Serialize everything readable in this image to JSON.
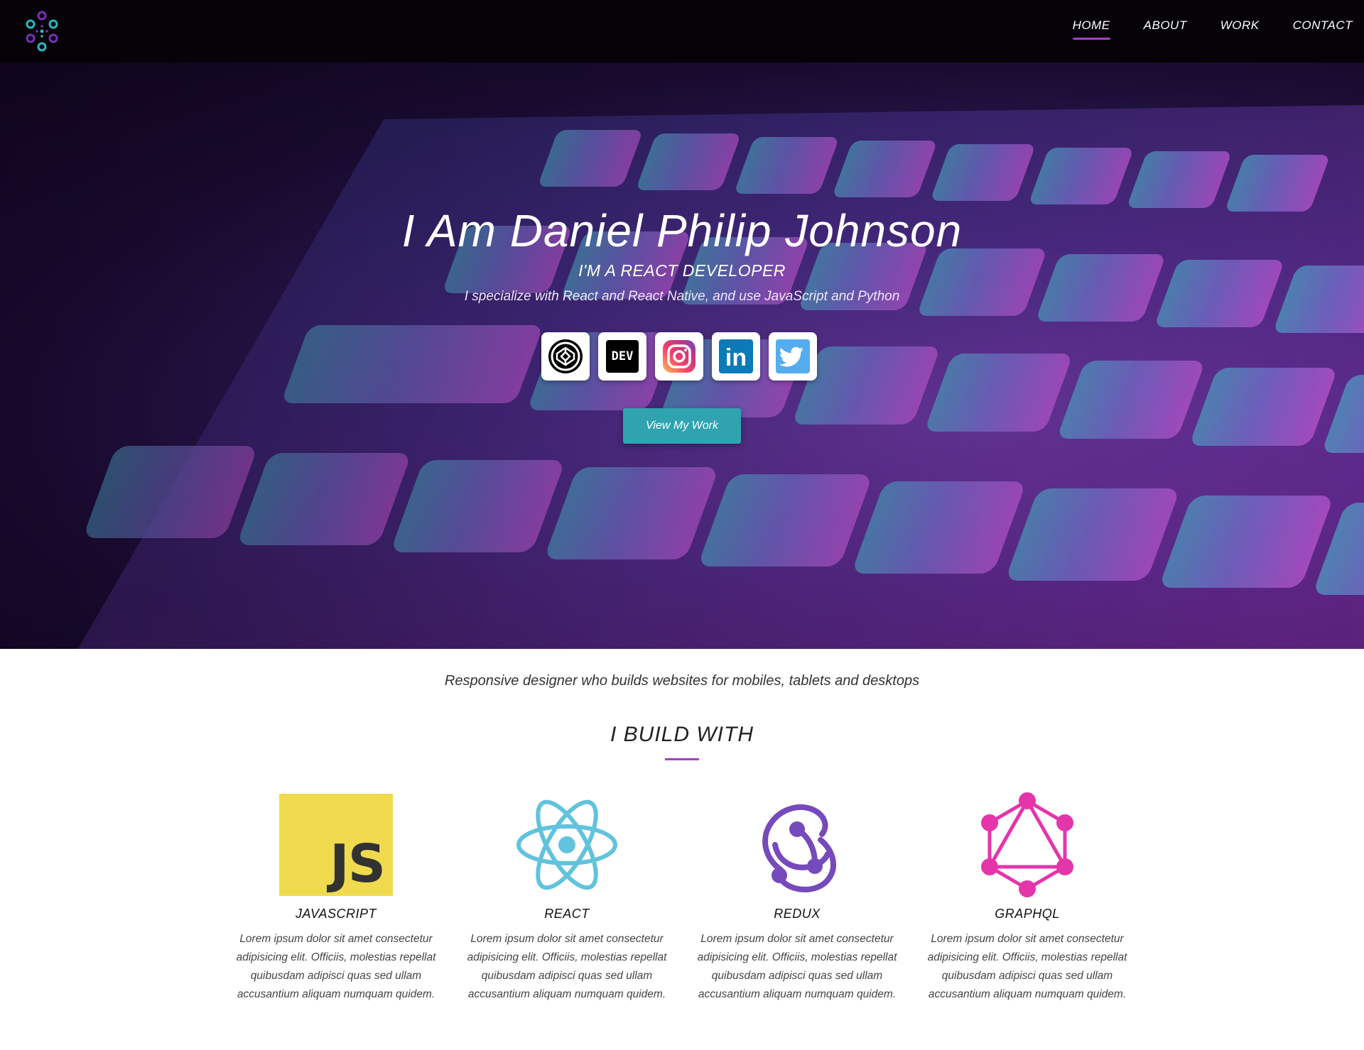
{
  "nav": {
    "logo_icon": "dots-circle-logo-icon",
    "links": [
      {
        "label": "HOME",
        "active": true
      },
      {
        "label": "ABOUT",
        "active": false
      },
      {
        "label": "WORK",
        "active": false
      },
      {
        "label": "CONTACT",
        "active": false
      }
    ]
  },
  "hero": {
    "title": "I Am Daniel Philip Johnson",
    "subtitle": "I'M A REACT DEVELOPER",
    "tagline": "I specialize with React and React Native, and use JavaScript and Python",
    "social": [
      {
        "name": "codepen-icon"
      },
      {
        "name": "dev-icon",
        "text": "DEV"
      },
      {
        "name": "instagram-icon"
      },
      {
        "name": "linkedin-icon",
        "text": "in"
      },
      {
        "name": "twitter-icon"
      }
    ],
    "cta_label": "View My Work"
  },
  "intro": {
    "text": "Responsive designer who builds websites for mobiles, tablets and desktops"
  },
  "build": {
    "heading": "I BUILD WITH",
    "items": [
      {
        "name": "JAVASCRIPT",
        "icon_text": "JS",
        "desc": "Lorem ipsum dolor sit amet consectetur adipisicing elit. Officiis, molestias repellat quibusdam adipisci quas sed ullam accusantium aliquam numquam quidem."
      },
      {
        "name": "REACT",
        "desc": "Lorem ipsum dolor sit amet consectetur adipisicing elit. Officiis, molestias repellat quibusdam adipisci quas sed ullam accusantium aliquam numquam quidem."
      },
      {
        "name": "REDUX",
        "desc": "Lorem ipsum dolor sit amet consectetur adipisicing elit. Officiis, molestias repellat quibusdam adipisci quas sed ullam accusantium aliquam numquam quidem."
      },
      {
        "name": "GRAPHQL",
        "desc": "Lorem ipsum dolor sit amet consectetur adipisicing elit. Officiis, molestias repellat quibusdam adipisci quas sed ullam accusantium aliquam numquam quidem."
      }
    ]
  },
  "colors": {
    "accent": "#a93fc3",
    "cta": "#2fa4b0",
    "nav_bg": "#050308",
    "js_yellow": "#f0db4f",
    "react_blue": "#61c3dc",
    "redux_purple": "#764abc",
    "graphql_pink": "#e535ab"
  }
}
